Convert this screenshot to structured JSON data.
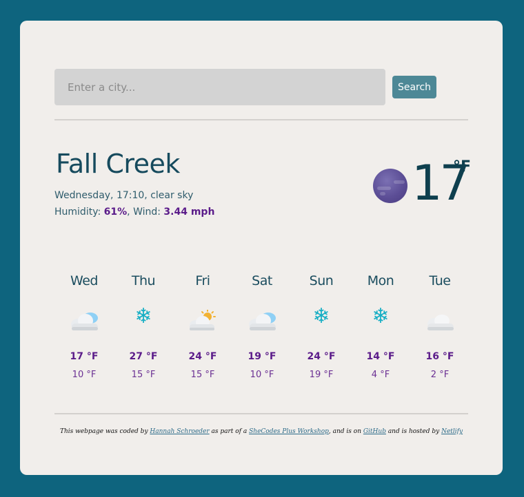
{
  "search": {
    "placeholder": "Enter a city...",
    "button_label": "Search"
  },
  "current": {
    "city": "Fall Creek",
    "date_desc": "Wednesday, 17:10, clear sky",
    "humidity_label": "Humidity:",
    "humidity": "61%",
    "wind_label": "Wind:",
    "wind": "3.44 mph",
    "temp": "17",
    "unit": "°F",
    "icon": "clear-night-moon-icon"
  },
  "forecast": [
    {
      "day": "Wed",
      "icon": "cloudy-icon",
      "max": "17 °F",
      "min": "10 °F"
    },
    {
      "day": "Thu",
      "icon": "snow-icon",
      "max": "27 °F",
      "min": "15 °F"
    },
    {
      "day": "Fri",
      "icon": "partly-sunny-icon",
      "max": "24 °F",
      "min": "15 °F"
    },
    {
      "day": "Sat",
      "icon": "cloudy-icon",
      "max": "19 °F",
      "min": "10 °F"
    },
    {
      "day": "Sun",
      "icon": "snow-icon",
      "max": "24 °F",
      "min": "19 °F"
    },
    {
      "day": "Mon",
      "icon": "snow-icon",
      "max": "14 °F",
      "min": "4 °F"
    },
    {
      "day": "Tue",
      "icon": "overcast-icon",
      "max": "16 °F",
      "min": "2 °F"
    }
  ],
  "footer": {
    "t1": "This webpage was coded by ",
    "author": "Hannah Schroeder",
    "t2": " as part of a ",
    "workshop": "SheCodes Plus Workshop",
    "t3": ", and is on ",
    "github": "GitHub",
    "t4": " and is hosted by ",
    "netlify": "Netlify"
  },
  "colors": {
    "background": "#0e647e",
    "card": "#f1eeeb",
    "accent": "#5b1c8a",
    "button": "#4d8896"
  }
}
